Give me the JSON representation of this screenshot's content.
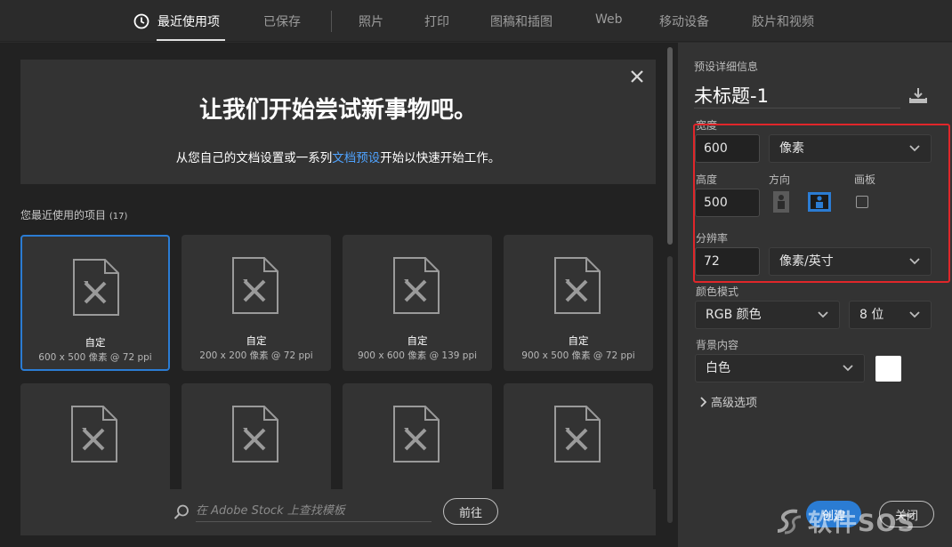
{
  "nav": {
    "tabs": [
      {
        "label": "最近使用项",
        "active": true
      },
      {
        "label": "已保存"
      },
      {
        "label": "照片"
      },
      {
        "label": "打印"
      },
      {
        "label": "图稿和插图"
      },
      {
        "label": "Web"
      },
      {
        "label": "移动设备"
      },
      {
        "label": "胶片和视频"
      }
    ]
  },
  "hero": {
    "title": "让我们开始尝试新事物吧。",
    "sub_before": "从您自己的文档设置或一系列",
    "sub_link": "文档预设",
    "sub_after": "开始以快速开始工作。"
  },
  "recent": {
    "label": "您最近使用的项目",
    "count": "(17)",
    "items": [
      {
        "name": "自定",
        "size": "600 x 500 像素 @ 72 ppi",
        "selected": true
      },
      {
        "name": "自定",
        "size": "200 x 200 像素 @ 72 ppi"
      },
      {
        "name": "自定",
        "size": "900 x 600 像素 @ 139 ppi"
      },
      {
        "name": "自定",
        "size": "900 x 500 像素 @ 72 ppi"
      },
      {
        "name": "",
        "size": ""
      },
      {
        "name": "",
        "size": ""
      },
      {
        "name": "",
        "size": ""
      },
      {
        "name": "",
        "size": ""
      }
    ]
  },
  "stock": {
    "placeholder": "在 Adobe Stock 上查找模板",
    "go_label": "前往"
  },
  "panel": {
    "section_label": "预设详细信息",
    "doc_title": "未标题-1",
    "width_label": "宽度",
    "width_value": "600",
    "width_unit": "像素",
    "height_label": "高度",
    "height_value": "500",
    "orientation_label": "方向",
    "artboard_label": "画板",
    "resolution_label": "分辨率",
    "resolution_value": "72",
    "resolution_unit": "像素/英寸",
    "color_mode_label": "颜色模式",
    "color_mode": "RGB 颜色",
    "bit_depth": "8 位",
    "background_label": "背景内容",
    "background": "白色",
    "background_color": "#ffffff",
    "advanced_label": "高级选项",
    "create_label": "创建",
    "close_label": "关闭"
  },
  "watermark": {
    "text": "软件SOS"
  },
  "colors": {
    "accent": "#2b7cd3",
    "highlight_box": "#e0262a",
    "link": "#4fa3ff"
  }
}
